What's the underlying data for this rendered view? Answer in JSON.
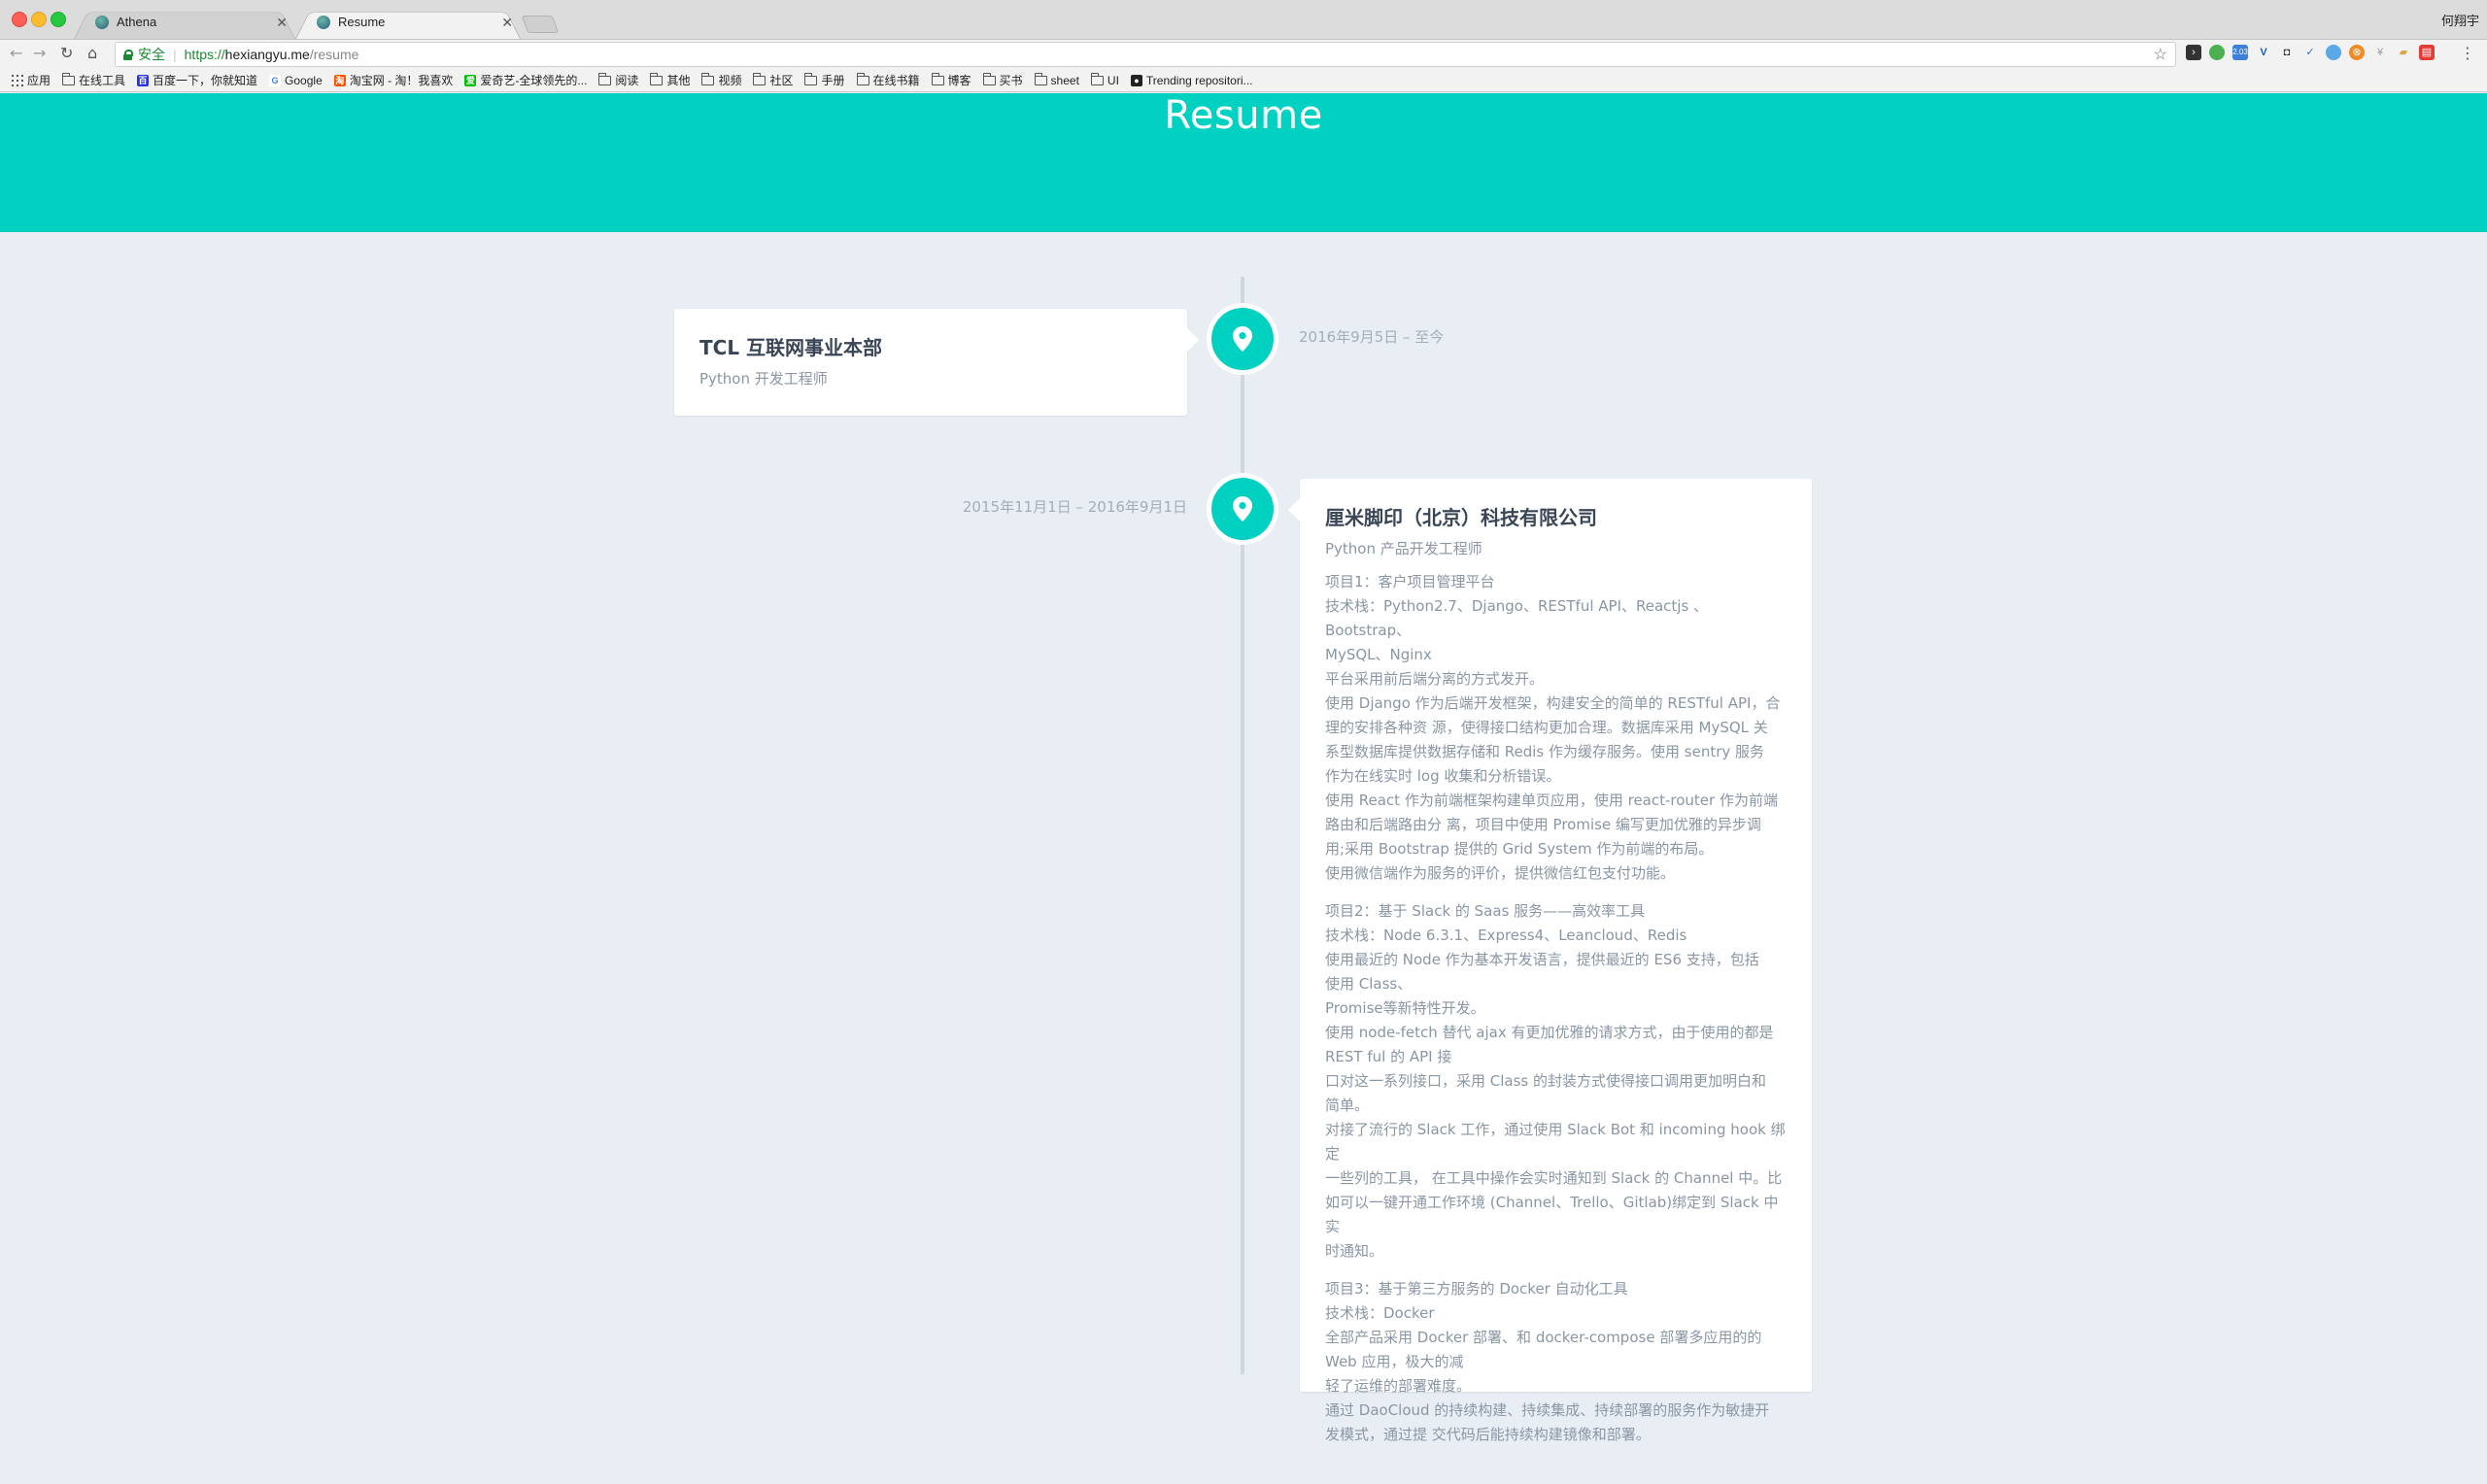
{
  "browser": {
    "tabs": [
      {
        "title": "Athena",
        "active": false
      },
      {
        "title": "Resume",
        "active": true
      }
    ],
    "user_name": "何翔宇",
    "address": {
      "secure_label": "安全",
      "scheme": "https://",
      "host": "hexiangyu.me",
      "path": "/resume"
    },
    "bookmarks": [
      {
        "label": "应用",
        "icon": "apps-grid-icon"
      },
      {
        "label": "在线工具",
        "icon": "folder-icon"
      },
      {
        "label": "百度一下，你就知道",
        "icon": "baidu-icon"
      },
      {
        "label": "Google",
        "icon": "google-icon"
      },
      {
        "label": "淘宝网 - 淘！我喜欢",
        "icon": "taobao-icon"
      },
      {
        "label": "爱奇艺-全球领先的...",
        "icon": "iqiyi-icon"
      },
      {
        "label": "阅读",
        "icon": "folder-icon"
      },
      {
        "label": "其他",
        "icon": "folder-icon"
      },
      {
        "label": "视频",
        "icon": "folder-icon"
      },
      {
        "label": "社区",
        "icon": "folder-icon"
      },
      {
        "label": "手册",
        "icon": "folder-icon"
      },
      {
        "label": "在线书籍",
        "icon": "folder-icon"
      },
      {
        "label": "博客",
        "icon": "folder-icon"
      },
      {
        "label": "买书",
        "icon": "folder-icon"
      },
      {
        "label": "sheet",
        "icon": "folder-icon"
      },
      {
        "label": "UI",
        "icon": "folder-icon"
      },
      {
        "label": "Trending repositori...",
        "icon": "github-icon"
      }
    ],
    "extension_badge": "2.03"
  },
  "page": {
    "title": "Resume",
    "accent_color": "#00d1c1",
    "background_color": "#e9eef5"
  },
  "experience": [
    {
      "company": "TCL 互联网事业本部",
      "role": "Python 开发工程师",
      "date": "2016年9月5日 – 至今"
    },
    {
      "company": "厘米脚印（北京）科技有限公司",
      "role": "Python 产品开发工程师",
      "date": "2015年11月1日 – 2016年9月1日",
      "projects": [
        [
          "项目1：客户项目管理平台",
          "技术栈：Python2.7、Django、RESTful API、Reactjs 、Bootstrap、",
          "MySQL、Nginx",
          "平台采用前后端分离的方式发开。",
          "使用 Django 作为后端开发框架，构建安全的简单的 RESTful API，合",
          "理的安排各种资 源，使得接口结构更加合理。数据库采用 MySQL 关",
          "系型数据库提供数据存储和 Redis 作为缓存服务。使用 sentry 服务",
          "作为在线实时 log 收集和分析错误。",
          "使用 React 作为前端框架构建单页应用，使用 react-router 作为前端",
          "路由和后端路由分 离，项目中使用 Promise 编写更加优雅的异步调",
          "用;采用 Bootstrap 提供的 Grid System 作为前端的布局。",
          "使用微信端作为服务的评价，提供微信红包支付功能。"
        ],
        [
          "项目2：基于 Slack 的 Saas 服务——高效率工具",
          "技术栈：Node 6.3.1、Express4、Leancloud、Redis",
          "使用最近的 Node 作为基本开发语言，提供最近的 ES6 支持，包括",
          "使用 Class、",
          "Promise等新特性开发。",
          "使用 node-fetch 替代 ajax 有更加优雅的请求方式，由于使用的都是",
          "REST ful 的 API 接",
          "口对这一系列接口，采用 Class 的封装方式使得接口调用更加明白和",
          "简单。",
          "对接了流行的 Slack 工作，通过使用 Slack Bot 和 incoming hook 绑定",
          "一些列的工具， 在工具中操作会实时通知到 Slack 的 Channel 中。比",
          "如可以一键开通工作环境 (Channel、Trello、Gitlab)绑定到 Slack 中实",
          "时通知。"
        ],
        [
          "项目3：基于第三方服务的 Docker 自动化工具",
          "技术栈：Docker",
          "全部产品采用 Docker 部署、和 docker-compose 部署多应用的的",
          "Web 应用，极大的减",
          "轻了运维的部署难度。",
          "通过 DaoCloud 的持续构建、持续集成、持续部署的服务作为敏捷开",
          "发模式，通过提 交代码后能持续构建镜像和部署。"
        ]
      ]
    }
  ]
}
